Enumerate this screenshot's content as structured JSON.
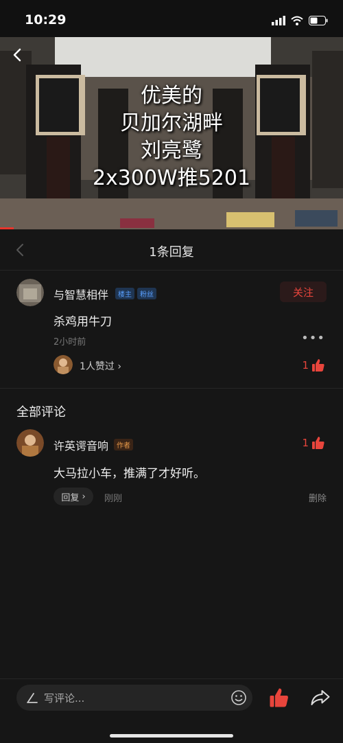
{
  "status": {
    "time": "10:29"
  },
  "video": {
    "caption_lines": [
      "优美的",
      "贝加尔湖畔",
      "刘亮鹭",
      "2x300W推5201"
    ],
    "progress": 0.04
  },
  "reply_header": {
    "title": "1条回复"
  },
  "original_comment": {
    "user": "与智慧相伴",
    "tags": [
      "楼主",
      "粉丝"
    ],
    "follow_label": "关注",
    "text": "杀鸡用牛刀",
    "time": "2小时前",
    "liked_by": "1人赞过",
    "like_count": "1"
  },
  "section": {
    "title": "全部评论"
  },
  "reply": {
    "user": "许英谔音响",
    "badge": "作者",
    "text": "大马拉小车，推满了才好听。",
    "reply_label": "回复",
    "time": "刚刚",
    "delete_label": "删除",
    "like_count": "1"
  },
  "bottom": {
    "placeholder": "写评论..."
  },
  "colors": {
    "accent": "#e8453c",
    "background": "#161616"
  }
}
